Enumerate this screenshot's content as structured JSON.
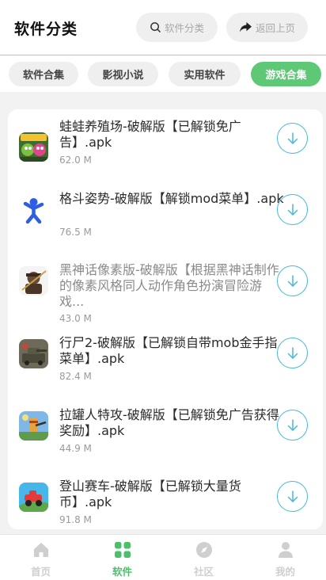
{
  "header": {
    "title": "软件分类",
    "search_label": "软件分类",
    "back_label": "返回上页"
  },
  "tabs": [
    {
      "label": "软件合集",
      "active": false
    },
    {
      "label": "影视小说",
      "active": false
    },
    {
      "label": "实用软件",
      "active": false
    },
    {
      "label": "游戏合集",
      "active": true
    }
  ],
  "apps": [
    {
      "title": "蛙蛙养殖场-破解版【已解锁免广告】.apk",
      "size": "62.0 M",
      "icon": "frog-farm-game-icon"
    },
    {
      "title": "格斗姿势-破解版【解锁mod菜单】.apk",
      "size": "76.5 M",
      "icon": "blue-ragdoll-fighter-icon"
    },
    {
      "title": "黑神话像素版-破解版【根据黑神话制作的像素风格同人动作角色扮演冒险游戏...",
      "size": "43.0 M",
      "icon": "monkey-warrior-icon"
    },
    {
      "title": "行尸2-破解版【已解锁自带mob金手指菜单】.apk",
      "size": "82.4 M",
      "icon": "zombie-tank-icon"
    },
    {
      "title": "拉罐人特攻-破解版【已解锁免广告获得奖励】.apk",
      "size": "44.9 M",
      "icon": "can-man-soldier-icon"
    },
    {
      "title": "登山赛车-破解版【已解锁大量货币】.apk",
      "size": "91.8 M",
      "icon": "hill-climb-car-icon"
    }
  ],
  "nav": [
    {
      "label": "首页",
      "icon": "home-icon",
      "active": false
    },
    {
      "label": "软件",
      "icon": "grid-apps-icon",
      "active": true
    },
    {
      "label": "社区",
      "icon": "compass-icon",
      "active": false
    },
    {
      "label": "我的",
      "icon": "person-icon",
      "active": false
    }
  ],
  "colors": {
    "accent_green": "#5fc877",
    "download_blue": "#46b9d8"
  }
}
